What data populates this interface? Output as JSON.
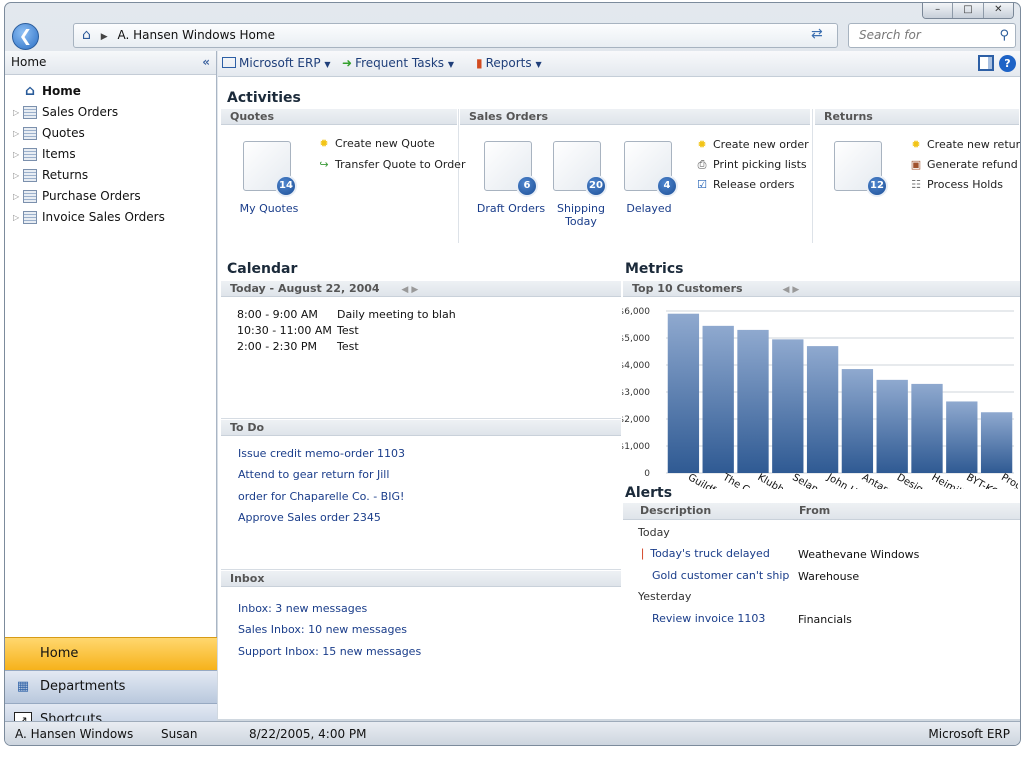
{
  "window": {
    "controls": [
      "–",
      "□",
      "✕"
    ]
  },
  "address": {
    "crumb": "A. Hansen Windows Home",
    "search_placeholder": "Search for"
  },
  "sidebar": {
    "header": "Home",
    "collapse": "«",
    "tree": [
      {
        "label": "Home"
      },
      {
        "label": "Sales Orders"
      },
      {
        "label": "Quotes"
      },
      {
        "label": "Items"
      },
      {
        "label": "Returns"
      },
      {
        "label": "Purchase Orders"
      },
      {
        "label": "Invoice Sales Orders"
      }
    ],
    "nav": [
      {
        "label": "Home"
      },
      {
        "label": "Departments"
      },
      {
        "label": "Shortcuts"
      }
    ]
  },
  "toolbar": {
    "erp": "Microsoft ERP",
    "tasks": "Frequent Tasks",
    "reports": "Reports",
    "help": "?"
  },
  "activities": {
    "title": "Activities",
    "quotes": {
      "header": "Quotes",
      "stack": {
        "label": "My Quotes",
        "count": "14"
      },
      "tasks": [
        "Create new Quote",
        "Transfer Quote to Order"
      ]
    },
    "sales_orders": {
      "header": "Sales Orders",
      "stacks": [
        {
          "label": "Draft Orders",
          "count": "6"
        },
        {
          "label": "Shipping Today",
          "count": "20"
        },
        {
          "label": "Delayed",
          "count": "4"
        }
      ],
      "tasks": [
        "Create new order",
        "Print picking lists",
        "Release orders"
      ]
    },
    "returns": {
      "header": "Returns",
      "stack": {
        "count": "12"
      },
      "tasks": [
        "Create new return",
        "Generate refund",
        "Process Holds"
      ]
    }
  },
  "calendar": {
    "title": "Calendar",
    "header": "Today - August 22, 2004",
    "events": [
      {
        "time": "8:00 - 9:00 AM",
        "desc": "Daily meeting to blah"
      },
      {
        "time": "10:30 - 11:00 AM",
        "desc": "Test"
      },
      {
        "time": "2:00 - 2:30 PM",
        "desc": "Test"
      }
    ]
  },
  "todo": {
    "header": "To Do",
    "items": [
      "Issue credit memo-order 1103",
      "Attend to gear return for Jill",
      "order for Chaparelle Co. - BIG!",
      "Approve Sales order 2345"
    ]
  },
  "inbox": {
    "header": "Inbox",
    "items": [
      "Inbox: 3 new messages",
      "Sales Inbox: 10 new messages",
      "Support Inbox: 15 new messages"
    ]
  },
  "metrics": {
    "title": "Metrics",
    "header": "Top 10 Customers"
  },
  "chart_data": {
    "type": "bar",
    "title": "Top 10 Customers",
    "categories": [
      "Guildford Water ...",
      "The Cannon Grou...",
      "Klubben",
      "Selangorian Ltd.",
      "John Haddock Ins...",
      "Antarcticopy",
      "Designstuido Gm...",
      "Heimilisprydi",
      "BYT-KOMPLE...",
      "Prog..."
    ],
    "values": [
      5900,
      5450,
      5300,
      4950,
      4700,
      3850,
      3450,
      3300,
      2650,
      2250
    ],
    "yticks": [
      "0",
      "$1,000",
      "$2,000",
      "$3,000",
      "$4,000",
      "$5,000",
      "$6,000"
    ],
    "ylim": [
      0,
      6000
    ],
    "bar_color": "#2f5a93"
  },
  "alerts": {
    "title": "Alerts",
    "col_desc": "Description",
    "col_from": "From",
    "group_today": "Today",
    "group_yesterday": "Yesterday",
    "rows": [
      {
        "desc": "Today's truck delayed",
        "from": "Weathevane Windows"
      },
      {
        "desc": "Gold customer can't ship",
        "from": "Warehouse"
      },
      {
        "desc": "Review invoice 1103",
        "from": "Financials"
      }
    ]
  },
  "status": {
    "company": "A. Hansen Windows",
    "user": "Susan",
    "datetime": "8/22/2005, 4:00 PM",
    "product": "Microsoft ERP"
  }
}
